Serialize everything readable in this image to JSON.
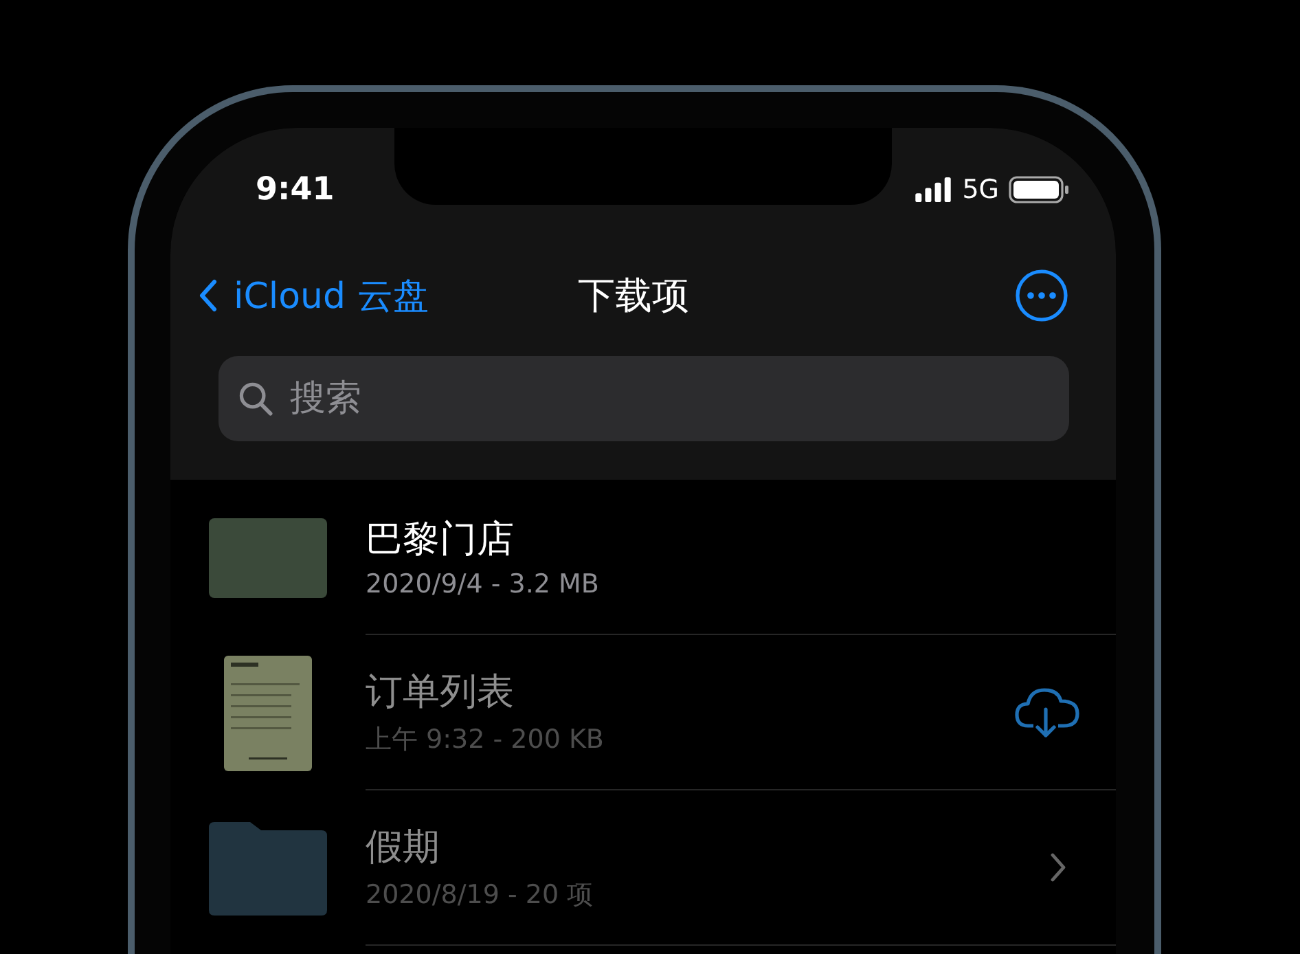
{
  "status_bar": {
    "time": "9:41",
    "network": "5G"
  },
  "nav": {
    "back_label": "iCloud 云盘",
    "title": "下载项"
  },
  "search": {
    "placeholder": "搜索"
  },
  "files": [
    {
      "name": "巴黎门店",
      "detail": "2020/9/4 - 3.2 MB",
      "kind": "photo",
      "dimmed": false
    },
    {
      "name": "订单列表",
      "detail": "上午 9:32 - 200 KB",
      "kind": "document",
      "accessory": {
        "kind": "download"
      },
      "dimmed": true
    },
    {
      "name": "假期",
      "detail": "2020/8/19 - 20 项",
      "kind": "folder",
      "accessory": {
        "kind": "chevron"
      },
      "dimmed": true
    }
  ]
}
